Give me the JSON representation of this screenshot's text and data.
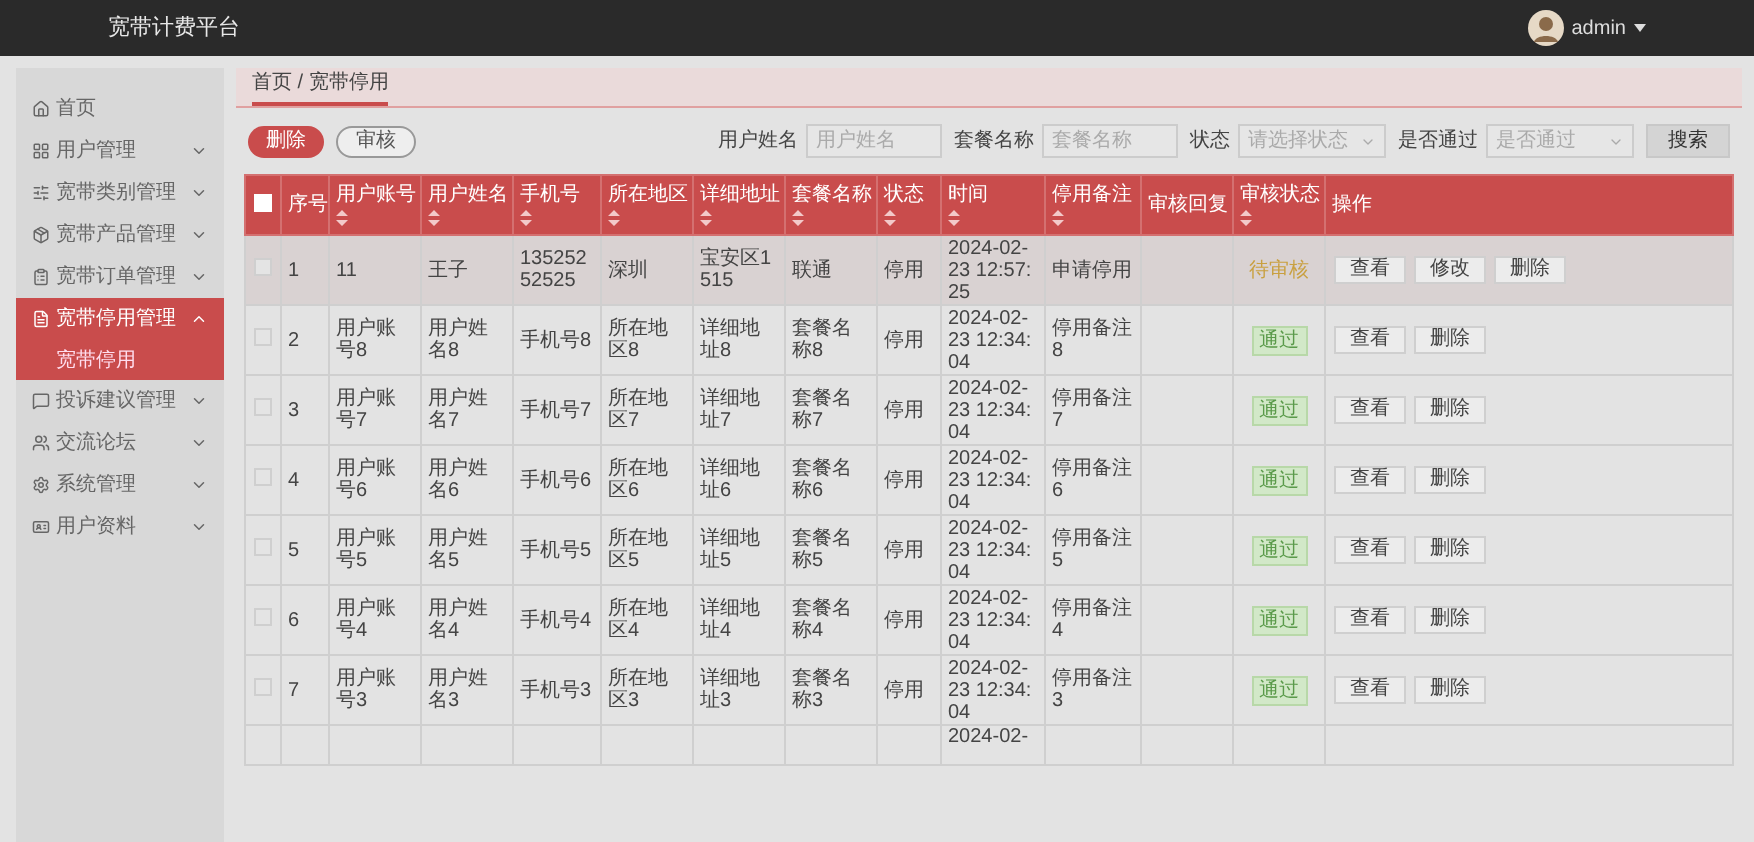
{
  "header": {
    "title": "宽带计费平台",
    "user": "admin"
  },
  "sidebar": {
    "items": [
      {
        "label": "首页",
        "kind": "link",
        "selected": false
      },
      {
        "label": "用户管理",
        "kind": "menu",
        "selected": false,
        "expanded": false
      },
      {
        "label": "宽带类别管理",
        "kind": "menu",
        "selected": false,
        "expanded": false
      },
      {
        "label": "宽带产品管理",
        "kind": "menu",
        "selected": false,
        "expanded": false
      },
      {
        "label": "宽带订单管理",
        "kind": "menu",
        "selected": false,
        "expanded": false
      },
      {
        "label": "宽带停用管理",
        "kind": "menu",
        "selected": true,
        "expanded": true,
        "children": [
          {
            "label": "宽带停用",
            "selected": true
          }
        ]
      },
      {
        "label": "投诉建议管理",
        "kind": "menu",
        "selected": false,
        "expanded": false
      },
      {
        "label": "交流论坛",
        "kind": "menu",
        "selected": false,
        "expanded": false
      },
      {
        "label": "系统管理",
        "kind": "menu",
        "selected": false,
        "expanded": false
      },
      {
        "label": "用户资料",
        "kind": "menu",
        "selected": false,
        "expanded": false
      }
    ]
  },
  "breadcrumb": "首页 / 宽带停用",
  "toolbar": {
    "buttons": [
      {
        "label": "删除",
        "kind": "primary"
      },
      {
        "label": "审核",
        "kind": "outline"
      }
    ],
    "filters": [
      {
        "label": "用户姓名",
        "kind": "input",
        "placeholder": "用户姓名"
      },
      {
        "label": "套餐名称",
        "kind": "input",
        "placeholder": "套餐名称"
      },
      {
        "label": "状态",
        "kind": "select",
        "placeholder": "请选择状态"
      },
      {
        "label": "是否通过",
        "kind": "select",
        "placeholder": "是否通过"
      }
    ],
    "search": "搜索"
  },
  "table": {
    "select_all_checked": false,
    "columns": [
      {
        "label": "序号",
        "sortable": false
      },
      {
        "label": "用户账号",
        "sortable": true
      },
      {
        "label": "用户姓名",
        "sortable": true
      },
      {
        "label": "手机号",
        "sortable": true
      },
      {
        "label": "所在地区",
        "sortable": true
      },
      {
        "label": "详细地址",
        "sortable": true
      },
      {
        "label": "套餐名称",
        "sortable": true
      },
      {
        "label": "状态",
        "sortable": true
      },
      {
        "label": "时间",
        "sortable": true
      },
      {
        "label": "停用备注",
        "sortable": true
      },
      {
        "label": "审核回复",
        "sortable": false
      },
      {
        "label": "审核状态",
        "sortable": true
      },
      {
        "label": "操作",
        "sortable": false
      }
    ],
    "rows": [
      {
        "checked": false,
        "hover": true,
        "cells": [
          "1",
          "11",
          "王子",
          "13525252525",
          "深圳",
          "宝安区1515",
          "联通",
          "停用",
          "2024-02-23 12:57:25",
          "申请停用",
          ""
        ],
        "status": {
          "label": "待审核",
          "kind": "pending"
        },
        "actions": [
          "查看",
          "修改",
          "删除"
        ]
      },
      {
        "checked": false,
        "hover": false,
        "cells": [
          "2",
          "用户账号8",
          "用户姓名8",
          "手机号8",
          "所在地区8",
          "详细地址8",
          "套餐名称8",
          "停用",
          "2024-02-23 12:34:04",
          "停用备注8",
          ""
        ],
        "status": {
          "label": "通过",
          "kind": "approved"
        },
        "actions": [
          "查看",
          "删除"
        ]
      },
      {
        "checked": false,
        "hover": false,
        "cells": [
          "3",
          "用户账号7",
          "用户姓名7",
          "手机号7",
          "所在地区7",
          "详细地址7",
          "套餐名称7",
          "停用",
          "2024-02-23 12:34:04",
          "停用备注7",
          ""
        ],
        "status": {
          "label": "通过",
          "kind": "approved"
        },
        "actions": [
          "查看",
          "删除"
        ]
      },
      {
        "checked": false,
        "hover": false,
        "cells": [
          "4",
          "用户账号6",
          "用户姓名6",
          "手机号6",
          "所在地区6",
          "详细地址6",
          "套餐名称6",
          "停用",
          "2024-02-23 12:34:04",
          "停用备注6",
          ""
        ],
        "status": {
          "label": "通过",
          "kind": "approved"
        },
        "actions": [
          "查看",
          "删除"
        ]
      },
      {
        "checked": false,
        "hover": false,
        "cells": [
          "5",
          "用户账号5",
          "用户姓名5",
          "手机号5",
          "所在地区5",
          "详细地址5",
          "套餐名称5",
          "停用",
          "2024-02-23 12:34:04",
          "停用备注5",
          ""
        ],
        "status": {
          "label": "通过",
          "kind": "approved"
        },
        "actions": [
          "查看",
          "删除"
        ]
      },
      {
        "checked": false,
        "hover": false,
        "cells": [
          "6",
          "用户账号4",
          "用户姓名4",
          "手机号4",
          "所在地区4",
          "详细地址4",
          "套餐名称4",
          "停用",
          "2024-02-23 12:34:04",
          "停用备注4",
          ""
        ],
        "status": {
          "label": "通过",
          "kind": "approved"
        },
        "actions": [
          "查看",
          "删除"
        ]
      },
      {
        "checked": false,
        "hover": false,
        "cells": [
          "7",
          "用户账号3",
          "用户姓名3",
          "手机号3",
          "所在地区3",
          "详细地址3",
          "套餐名称3",
          "停用",
          "2024-02-23 12:34:04",
          "停用备注3",
          ""
        ],
        "status": {
          "label": "通过",
          "kind": "approved"
        },
        "actions": [
          "查看",
          "删除"
        ]
      }
    ],
    "partial_row": {
      "time": "2024-02-"
    }
  }
}
